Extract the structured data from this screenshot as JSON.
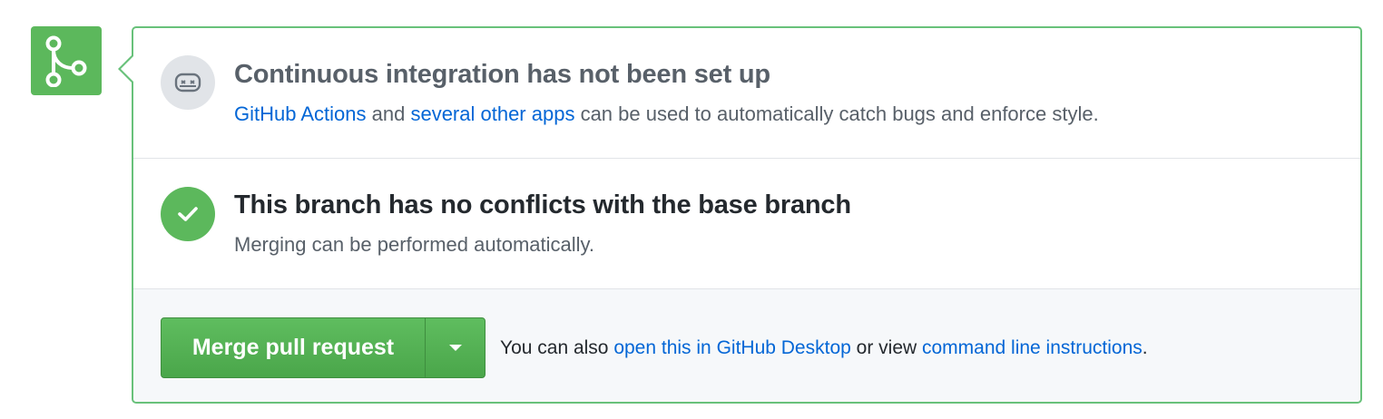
{
  "colors": {
    "success_green": "#5cb85c",
    "panel_border": "#68c17a",
    "link_blue": "#0366d6",
    "muted_gray": "#586069"
  },
  "icons": {
    "merge_badge": "git-merge-icon",
    "ci_status": "robot-icon",
    "conflict_status": "check-icon",
    "dropdown": "triangle-down-icon"
  },
  "ci": {
    "title": "Continuous integration has not been set up",
    "link1": "GitHub Actions",
    "text1": " and ",
    "link2": "several other apps",
    "text2": " can be used to automatically catch bugs and enforce style."
  },
  "conflicts": {
    "title": "This branch has no conflicts with the base branch",
    "description": "Merging can be performed automatically."
  },
  "merge": {
    "button_label": "Merge pull request",
    "note_prefix": "You can also ",
    "link_desktop": "open this in GitHub Desktop",
    "note_middle": " or view ",
    "link_cli": "command line instructions",
    "note_suffix": "."
  }
}
